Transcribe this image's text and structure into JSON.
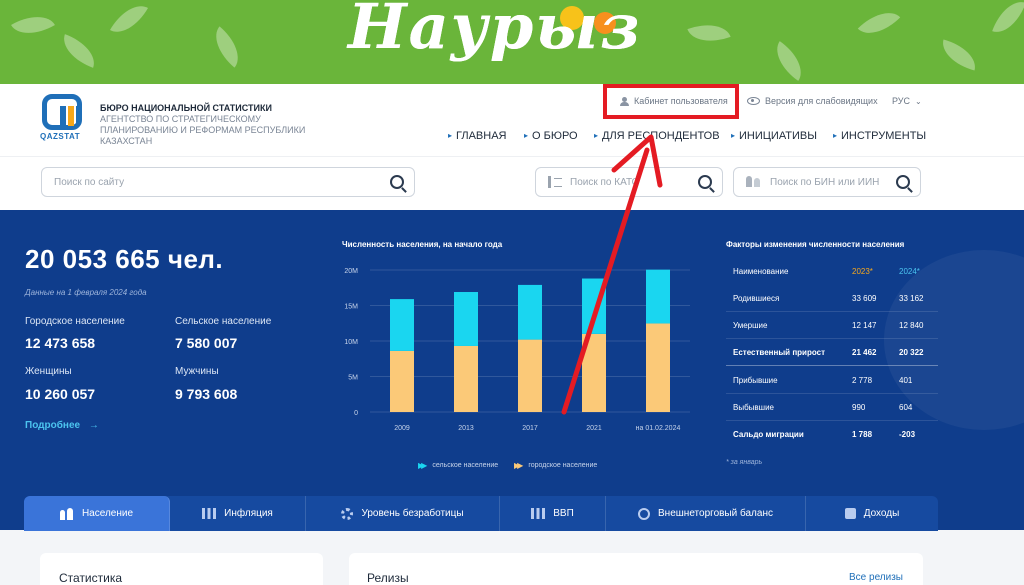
{
  "banner": {
    "title": "Наурыз",
    "colors": {
      "background": "#6ab53a"
    }
  },
  "header": {
    "logo_text": "QAZSTAT",
    "org_title": "БЮРО НАЦИОНАЛЬНОЙ СТАТИСТИКИ",
    "org_subtitle": "АГЕНТСТВО ПО СТРАТЕГИЧЕСКОМУ ПЛАНИРОВАНИЮ И РЕФОРМАМ РЕСПУБЛИКИ КАЗАХСТАН",
    "user_cabinet": "Кабинет пользователя",
    "low_vision": "Версия для слабовидящих",
    "language": "РУС",
    "nav": [
      "ГЛАВНАЯ",
      "О БЮРО",
      "ДЛЯ РЕСПОНДЕНТОВ",
      "ИНИЦИАТИВЫ",
      "ИНСТРУМЕНТЫ"
    ]
  },
  "search": {
    "site_placeholder": "Поиск по сайту",
    "kato_placeholder": "Поиск по КАТО",
    "bin_placeholder": "Поиск по БИН или ИИН"
  },
  "population": {
    "total": "20 053 665 чел.",
    "date_note": "Данные на 1 февраля 2024 года",
    "urban_label": "Городское население",
    "urban_value": "12 473 658",
    "rural_label": "Сельское население",
    "rural_value": "7 580 007",
    "women_label": "Женщины",
    "women_value": "10 260 057",
    "men_label": "Мужчины",
    "men_value": "9 793 608",
    "more": "Подробнее"
  },
  "chart_data": {
    "type": "bar",
    "title": "Численность населения, на начало года",
    "categories": [
      "2009",
      "2013",
      "2017",
      "2021",
      "на 01.02.2024"
    ],
    "series": [
      {
        "name": "городское население",
        "color": "#fbc978",
        "values": [
          8.6,
          9.3,
          10.2,
          11.0,
          12.47
        ]
      },
      {
        "name": "сельское население",
        "color": "#1ad6f0",
        "values": [
          7.3,
          7.6,
          7.7,
          7.8,
          7.58
        ]
      }
    ],
    "stacked": true,
    "ylim": [
      0,
      20
    ],
    "yticks": [
      "0",
      "5M",
      "10M",
      "15M",
      "20M"
    ],
    "legend": "bottom"
  },
  "factors": {
    "title": "Факторы изменения численности населения",
    "columns": [
      "Наименование",
      "2023*",
      "2024*"
    ],
    "rows": [
      [
        "Родившиеся",
        "33 609",
        "33 162"
      ],
      [
        "Умершие",
        "12 147",
        "12 840"
      ],
      [
        "Естественный прирост",
        "21 462",
        "20 322"
      ],
      [
        "Прибывшие",
        "2 778",
        "401"
      ],
      [
        "Выбывшие",
        "990",
        "604"
      ],
      [
        "Сальдо миграции",
        "1 788",
        "-203"
      ]
    ],
    "footnote": "* за январь"
  },
  "tabs": [
    "Население",
    "Инфляция",
    "Уровень безработицы",
    "ВВП",
    "Внешнеторговый баланс",
    "Доходы"
  ],
  "cards": {
    "stats_title": "Статистика",
    "releases_title": "Релизы",
    "all_releases": "Все релизы"
  },
  "annotation": {
    "color": "#e41b23"
  }
}
